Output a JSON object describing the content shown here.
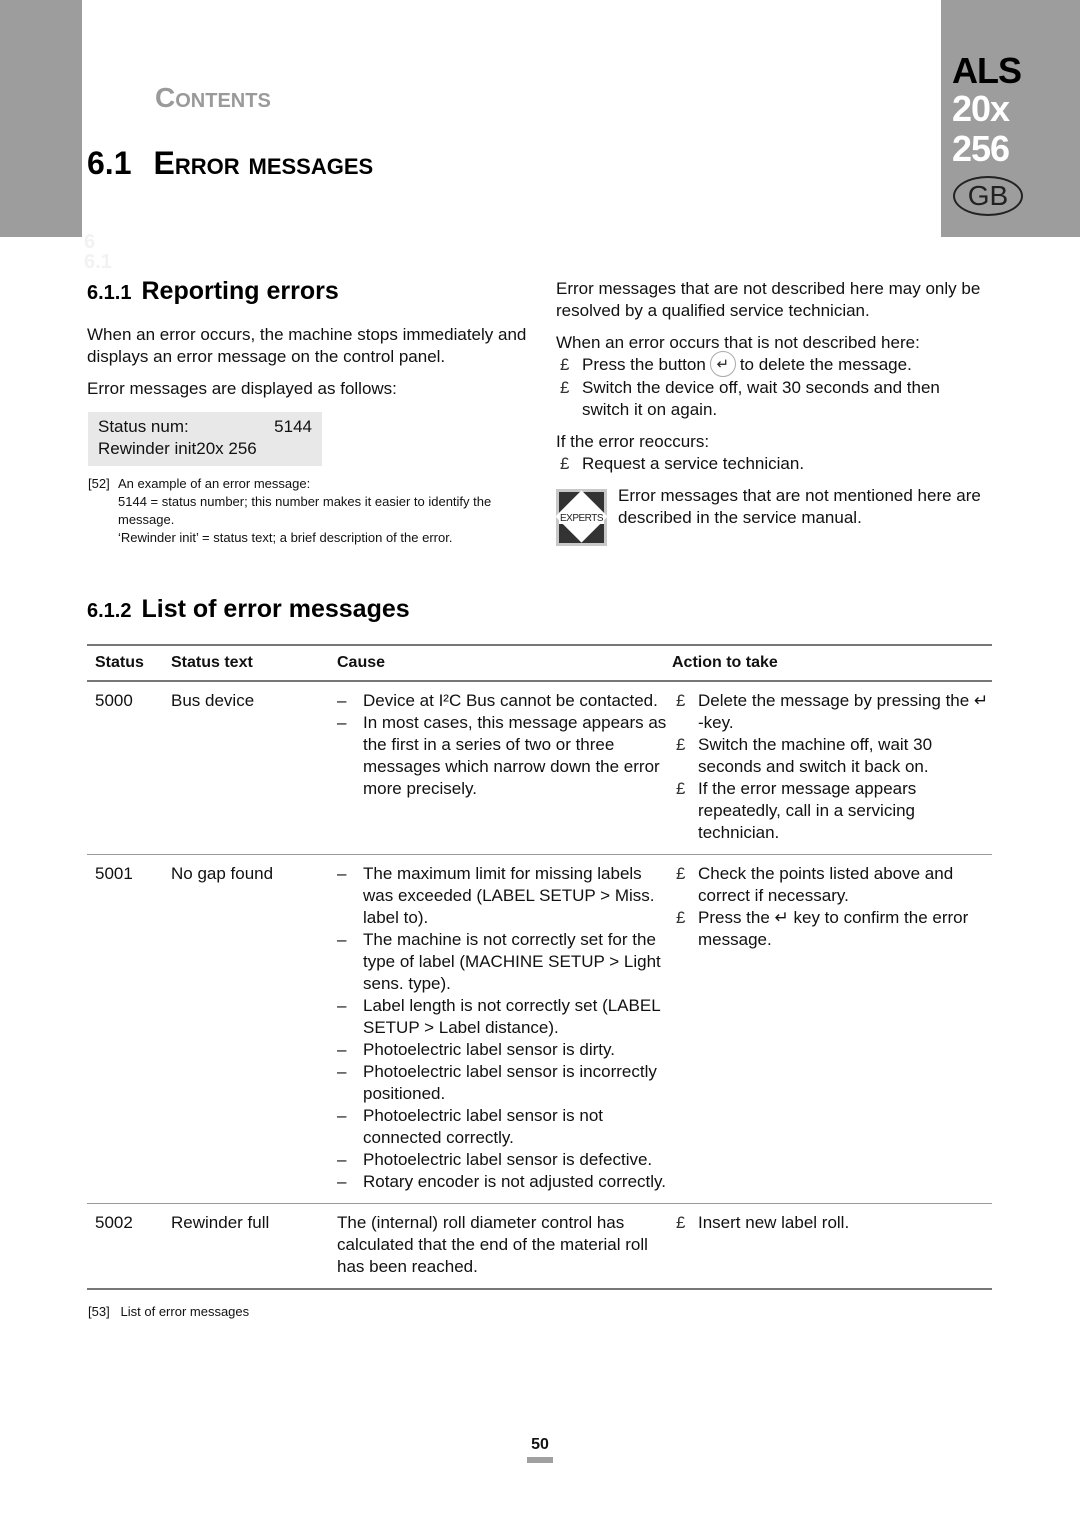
{
  "header": {
    "contents_label": "Contents",
    "chapter_number": "6.1",
    "chapter_title": "Error messages",
    "ghost_lines": [
      "6",
      "6.1"
    ],
    "product": "ALS",
    "model_line1": "20x",
    "model_line2": "256",
    "country_badge": "GB"
  },
  "section_reporting": {
    "number": "6.1.1",
    "title": "Reporting errors",
    "para1": "When an error occurs, the machine stops immediately and displays an error message on the control panel.",
    "para2": "Error messages are displayed as follows:",
    "display_example": {
      "label": "Status num:",
      "value": "5144",
      "text": "Rewinder init20x 256"
    },
    "figure": {
      "number": "[52]",
      "line1": "An example of an error message:",
      "line2": "5144 = status number; this number makes it easier to identify the message.",
      "line3": "‘Rewinder init’ = status text; a brief description of the error."
    }
  },
  "section_right": {
    "para1": "Error messages that are not described here may only be resolved by a qualified service technician.",
    "para2": "When an error occurs that is not described here:",
    "bullet_marker": "£",
    "bullet1_pre": "Press the button",
    "bullet1_post": "to delete the message.",
    "bullet2": "Switch the device off, wait 30 seconds and then switch it on again.",
    "para3": "If the error reoccurs:",
    "bullet3": "Request a service technician.",
    "experts_label": "EXPERTS",
    "experts_note": "Error messages that are not mentioned here are described in the service manual.",
    "enter_key_glyph": "↵"
  },
  "section_list": {
    "number": "6.1.2",
    "title": "List of error messages",
    "columns": [
      "Status",
      "Status text",
      "Cause",
      "Action to take"
    ],
    "rows": [
      {
        "status": "5000",
        "status_text": "Bus device",
        "causes": [
          "Device at I²C Bus cannot be contacted.",
          "In most cases, this message appears as the first in a series of two or three messages which narrow down the error more precisely."
        ],
        "actions": [
          "Delete the message by pressing the ↵ -key.",
          "Switch the machine off, wait 30 seconds and switch it back on.",
          "If the error message appears repeatedly, call in a servicing technician."
        ]
      },
      {
        "status": "5001",
        "status_text": "No gap found",
        "causes": [
          "The maximum limit for missing labels was exceeded (LABEL SETUP > Miss. label to).",
          "The machine is not correctly set for the type of label (MACHINE SETUP > Light sens. type).",
          "Label length is not correctly set (LABEL SETUP > Label distance).",
          "Photoelectric label sensor is dirty.",
          "Photoelectric label sensor is incorrectly positioned.",
          "Photoelectric label sensor is not connected correctly.",
          "Photoelectric label sensor is defective.",
          "Rotary encoder is not adjusted correctly."
        ],
        "actions": [
          "Check the points listed above and correct if necessary.",
          "Press the ↵ key to confirm the error message."
        ]
      },
      {
        "status": "5002",
        "status_text": "Rewinder full",
        "cause_text": "The (internal) roll diameter control has calculated that the end of the material roll has been reached.",
        "actions": [
          "Insert new label roll."
        ]
      }
    ],
    "figure": {
      "number": "[53]",
      "caption": "List of error messages"
    }
  },
  "footer": {
    "page_number": "50"
  },
  "ui": {
    "dash": "–"
  }
}
